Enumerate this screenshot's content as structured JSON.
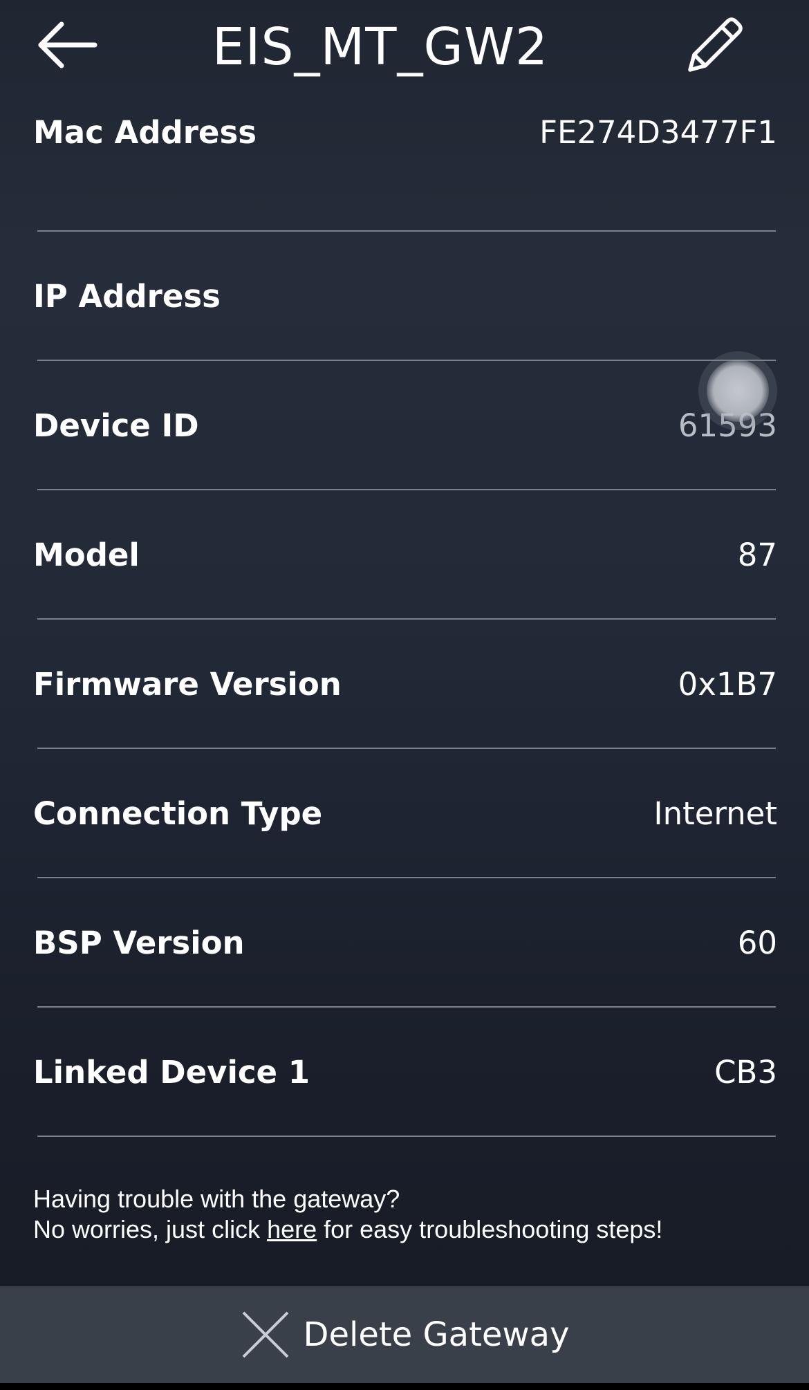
{
  "header": {
    "title": "EIS_MT_GW2",
    "back_icon": "arrow-left-icon",
    "edit_icon": "pencil-icon"
  },
  "rows": [
    {
      "label": "Mac Address",
      "value": "FE274D3477F1"
    },
    {
      "label": "IP Address",
      "value": ""
    },
    {
      "label": "Device ID",
      "value": "61593"
    },
    {
      "label": "Model",
      "value": "87"
    },
    {
      "label": "Firmware Version",
      "value": "0x1B7"
    },
    {
      "label": "Connection Type",
      "value": "Internet"
    },
    {
      "label": "BSP Version",
      "value": "60"
    },
    {
      "label": "Linked Device 1",
      "value": "CB3"
    }
  ],
  "help": {
    "line1": "Having trouble with the gateway?",
    "line2_prefix": "No worries, just click ",
    "link_text": "here",
    "line2_suffix": " for easy troubleshooting steps!"
  },
  "footer": {
    "delete_label": "Delete Gateway",
    "delete_icon": "x-icon"
  },
  "colors": {
    "background": "#1f2632",
    "divider": "#8a9099",
    "footer_bar": "#3a4049",
    "text": "#ffffff"
  }
}
